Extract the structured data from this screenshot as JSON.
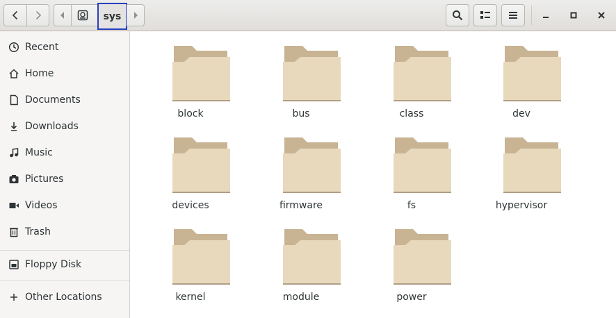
{
  "header": {
    "back_icon": "chevron-left-icon",
    "forward_icon": "chevron-right-icon",
    "path_prev_icon": "triangle-left-icon",
    "path_root_icon": "root-drive-icon",
    "path_current": "sys",
    "path_next_icon": "triangle-right-icon",
    "search_icon": "search-icon",
    "view_icon": "list-view-icon",
    "menu_icon": "hamburger-menu-icon",
    "minimize_icon": "minimize-icon",
    "maximize_icon": "maximize-icon",
    "close_icon": "close-icon"
  },
  "sidebar": {
    "items": [
      {
        "label": "Recent",
        "icon": "clock-icon"
      },
      {
        "label": "Home",
        "icon": "home-icon"
      },
      {
        "label": "Documents",
        "icon": "document-icon"
      },
      {
        "label": "Downloads",
        "icon": "download-icon"
      },
      {
        "label": "Music",
        "icon": "music-icon"
      },
      {
        "label": "Pictures",
        "icon": "camera-icon"
      },
      {
        "label": "Videos",
        "icon": "video-icon"
      },
      {
        "label": "Trash",
        "icon": "trash-icon"
      }
    ],
    "devices": [
      {
        "label": "Floppy Disk",
        "icon": "floppy-icon"
      }
    ],
    "other": {
      "label": "Other Locations",
      "icon": "plus-icon"
    }
  },
  "folders": [
    {
      "name": "block"
    },
    {
      "name": "bus"
    },
    {
      "name": "class"
    },
    {
      "name": "dev"
    },
    {
      "name": "devices"
    },
    {
      "name": "firmware"
    },
    {
      "name": "fs"
    },
    {
      "name": "hypervisor"
    },
    {
      "name": "kernel"
    },
    {
      "name": "module"
    },
    {
      "name": "power"
    }
  ],
  "colors": {
    "folder_body": "#e8d9bd",
    "folder_back": "#c8b393",
    "accent": "#2b3fbd"
  }
}
